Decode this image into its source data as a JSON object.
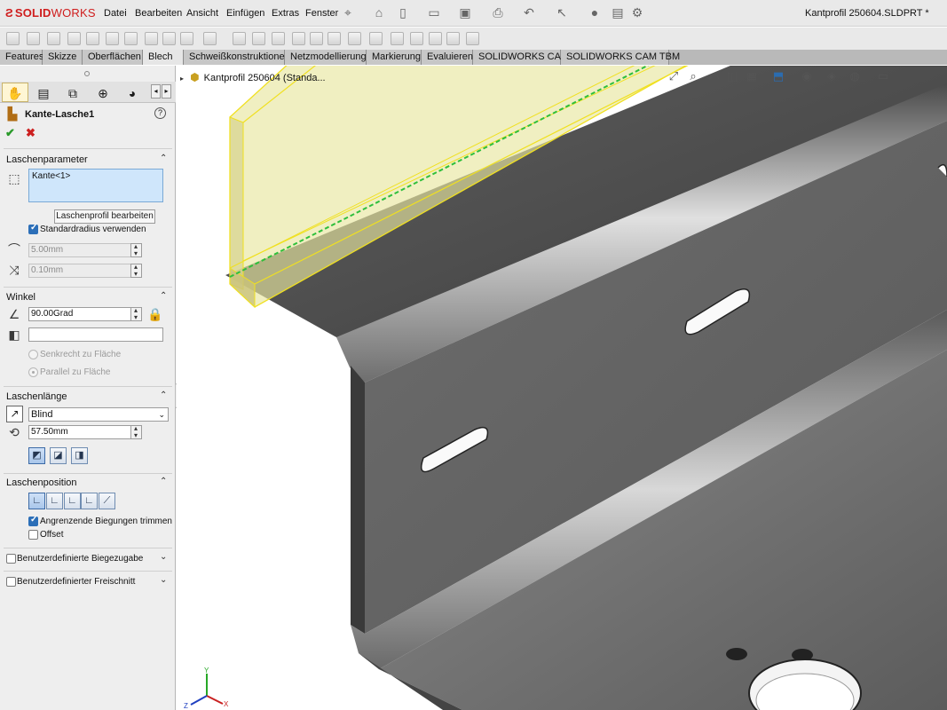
{
  "app": {
    "logo_ds": "Ƨ",
    "logo_solid": "SOLID",
    "logo_works": "WORKS",
    "document_title": "Kantprofil 250604.SLDPRT *"
  },
  "menu": [
    "Datei",
    "Bearbeiten",
    "Ansicht",
    "Einfügen",
    "Extras",
    "Fenster"
  ],
  "quick_icons": [
    "pin-icon",
    "home-icon",
    "new-document-icon",
    "open-icon",
    "save-icon",
    "print-icon",
    "undo-icon",
    "select-icon",
    "rebuild-icon",
    "options-icon"
  ],
  "tabs": [
    "Features",
    "Skizze",
    "Oberflächen",
    "Blech",
    "Schweißkonstruktionen",
    "Netzmodellierung",
    "Markierung",
    "Evaluieren",
    "SOLIDWORKS CAM",
    "SOLIDWORKS CAM TBM"
  ],
  "active_tab": "Blech",
  "pm": {
    "feature_title": "Kante-Lasche1",
    "ok": "✔",
    "cancel": "✖",
    "help": "?",
    "sections": {
      "laschenparameter": {
        "title": "Laschenparameter",
        "edge_selection": "Kante<1>",
        "edit_profile_button": "Laschenprofil bearbeiten",
        "use_default_radius": "Standardradius verwenden",
        "radius_value": "5.00mm",
        "gap_value": "0.10mm"
      },
      "winkel": {
        "title": "Winkel",
        "angle_value": "90.00Grad",
        "reference_face": "",
        "option_perpendicular": "Senkrecht zu Fläche",
        "option_parallel": "Parallel zu Fläche"
      },
      "laschenlaenge": {
        "title": "Laschenlänge",
        "end_condition": "Blind",
        "length_value": "57.50mm"
      },
      "laschenposition": {
        "title": "Laschenposition",
        "trim_adjacent_bends": "Angrenzende Biegungen trimmen",
        "offset": "Offset"
      },
      "custom_bend_allowance": "Benutzerdefinierte Biegezugabe",
      "custom_relief": "Benutzerdefinierter Freischnitt"
    }
  },
  "viewport": {
    "tree_root": "Kantprofil 250604 (Standa..."
  },
  "colors": {
    "accent": "#2c6fb8",
    "brand": "#cf1d1d",
    "preview_fill": "#e8e6a0",
    "preview_edge": "#f0e020",
    "selected_edge": "#2fbf3b",
    "model_dark": "#5a5a5a",
    "model_light": "#c9c9c9"
  }
}
